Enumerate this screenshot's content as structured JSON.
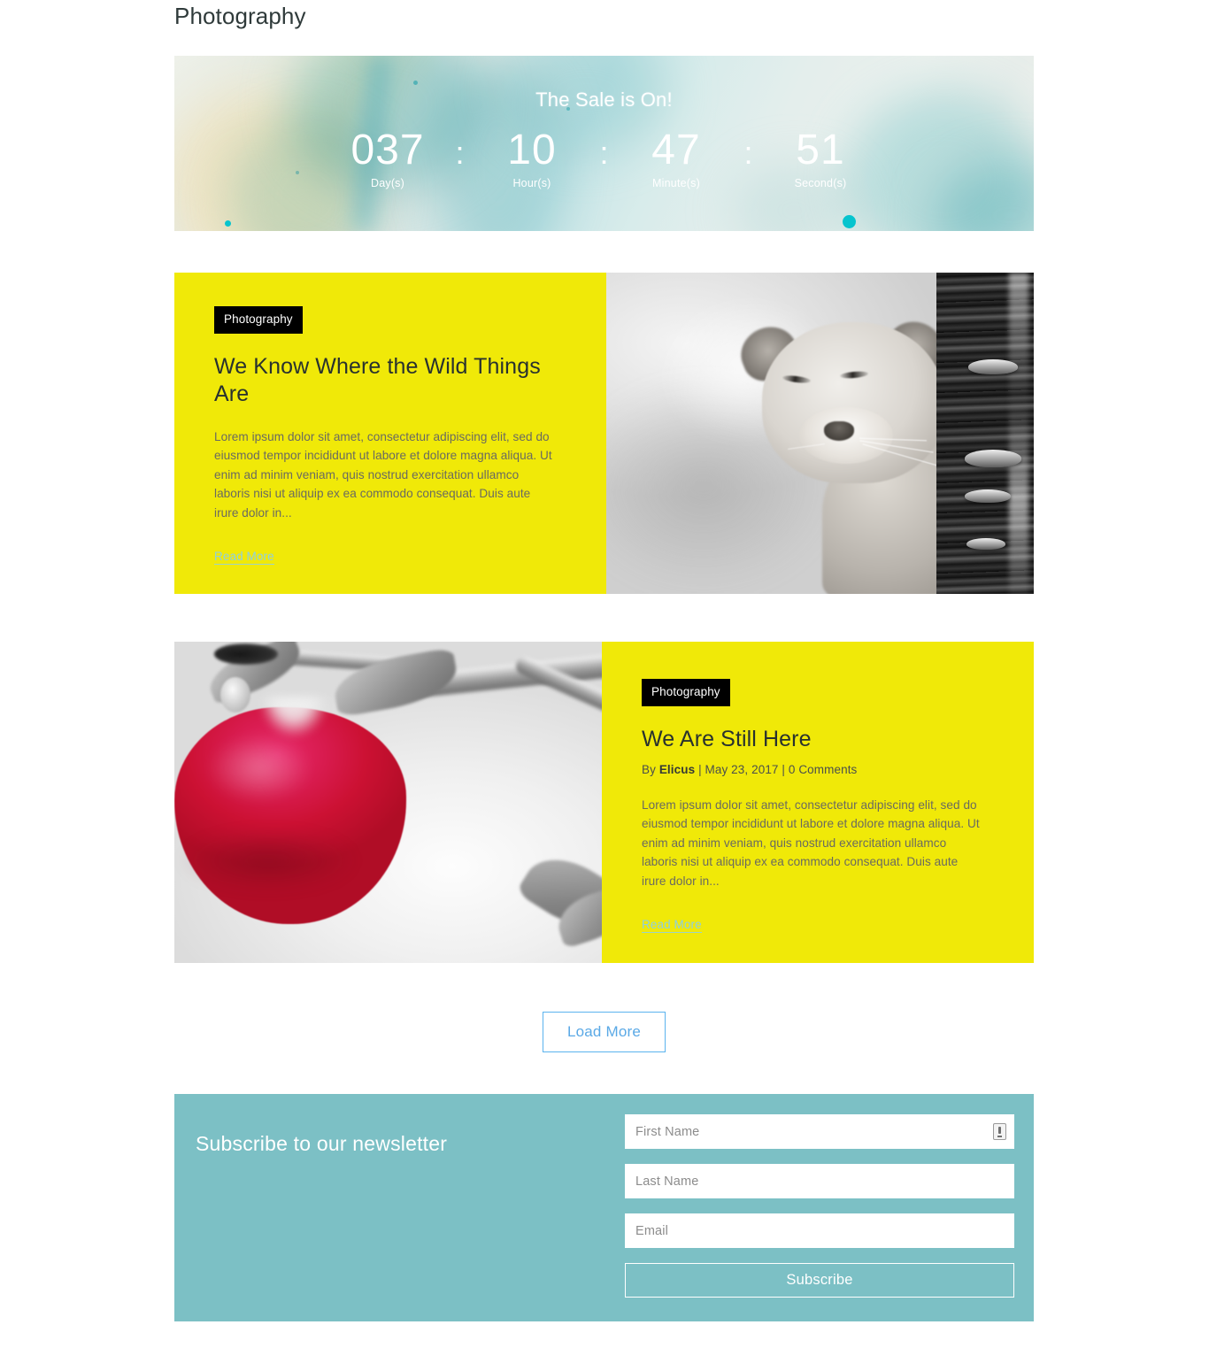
{
  "page": {
    "title": "Photography"
  },
  "countdown": {
    "heading": "The Sale is On!",
    "separator": ":",
    "units": [
      {
        "value": "037",
        "label": "Day(s)"
      },
      {
        "value": "10",
        "label": "Hour(s)"
      },
      {
        "value": "47",
        "label": "Minute(s)"
      },
      {
        "value": "51",
        "label": "Second(s)"
      }
    ]
  },
  "posts": [
    {
      "category": "Photography",
      "title": "We Know Where the Wild Things Are",
      "meta": null,
      "excerpt": "Lorem ipsum dolor sit amet, consectetur adipiscing elit, sed do eiusmod tempor incididunt ut labore et dolore magna aliqua. Ut enim ad minim veniam, quis nostrud exercitation ullamco laboris nisi ut aliquip ex ea commodo consequat. Duis aute irure dolor in...",
      "read_more": "Read More",
      "image_alt": "black-and-white lion cub beside tree trunk"
    },
    {
      "category": "Photography",
      "title": "We Are Still Here",
      "meta": {
        "by": "By",
        "author": "Elicus",
        "date": "May 23, 2017",
        "comments": "0 Comments",
        "divider": "|"
      },
      "excerpt": "Lorem ipsum dolor sit amet, consectetur adipiscing elit, sed do eiusmod tempor incididunt ut labore et dolore magna aliqua. Ut enim ad minim veniam, quis nostrud exercitation ullamco laboris nisi ut aliquip ex ea commodo consequat. Duis aute irure dolor in...",
      "read_more": "Read More",
      "image_alt": "red apple hanging on desaturated branch"
    }
  ],
  "load_more": {
    "label": "Load More"
  },
  "newsletter": {
    "title": "Subscribe to our newsletter",
    "fields": [
      {
        "name": "first-name",
        "placeholder": "First Name",
        "value": "",
        "icon": "autofill-contact-icon"
      },
      {
        "name": "last-name",
        "placeholder": "Last Name",
        "value": "",
        "icon": null
      },
      {
        "name": "email",
        "placeholder": "Email",
        "value": "",
        "icon": null
      }
    ],
    "submit_label": "Subscribe"
  },
  "colors": {
    "card_yellow": "#f0e908",
    "badge_black": "#000000",
    "newsletter_teal": "#7cc0c5",
    "load_more_blue": "#5aa9e6",
    "read_more_blue": "#8fcfe0",
    "accent_cyan_dot": "#06c4ce"
  }
}
